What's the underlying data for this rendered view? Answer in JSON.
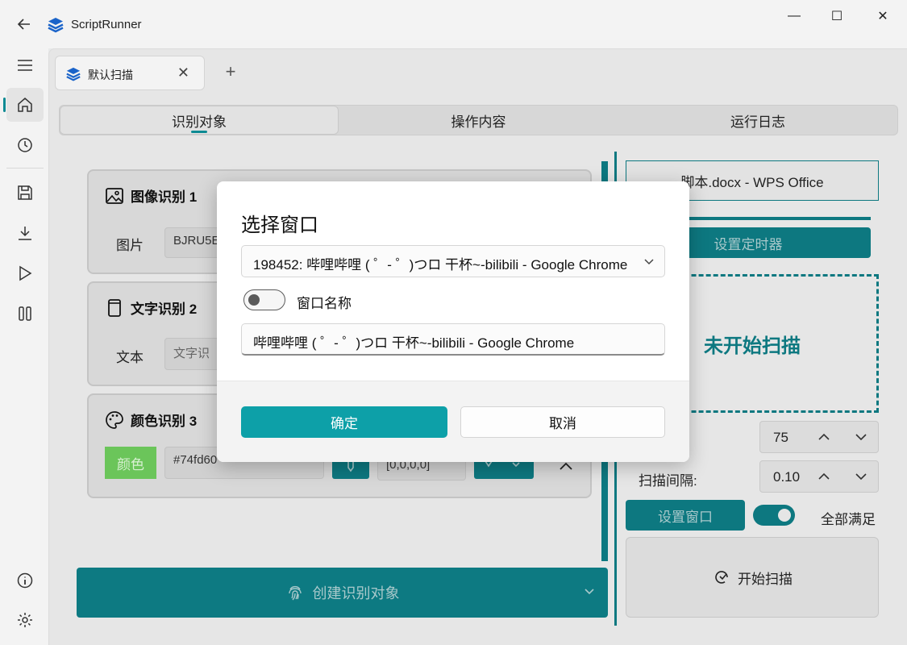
{
  "app": {
    "title": "ScriptRunner"
  },
  "window_controls": {
    "minimize": "—",
    "maximize": "☐",
    "close": "✕"
  },
  "tabs": [
    {
      "label": "默认扫描"
    }
  ],
  "segments": [
    {
      "label": "识别对象",
      "active": true
    },
    {
      "label": "操作内容",
      "active": false
    },
    {
      "label": "运行日志",
      "active": false
    }
  ],
  "cards": {
    "image": {
      "title": "图像识别 1",
      "row_label": "图片",
      "field_value": "BJRU5E"
    },
    "text": {
      "title": "文字识别 2",
      "row_label": "文本",
      "field_placeholder": "文字识"
    },
    "color": {
      "title": "颜色识别 3",
      "swatch_label": "颜色",
      "swatch_color": "#74fd60",
      "hex_value": "#74fd60",
      "rgba_value": "[0,0,0,0]"
    }
  },
  "create_button": {
    "label": "创建识别对象"
  },
  "right_panel": {
    "window_name": "脚本.docx - WPS Office",
    "timer_button": "设置定时器",
    "status": "未开始扫描",
    "threshold_value": "75",
    "interval_label": "扫描间隔:",
    "interval_value": "0.10",
    "set_window_button": "设置窗口",
    "all_satisfy_label": "全部满足",
    "start_button": "开始扫描"
  },
  "dialog": {
    "title": "选择窗口",
    "selected_window": "198452: 哔哩哔哩 ( ゜- ゜)つロ 干杯~-bilibili - Google Chrome",
    "toggle_label": "窗口名称",
    "window_name_value": "哔哩哔哩 ( ゜- ゜)つロ 干杯~-bilibili - Google Chrome",
    "ok_label": "确定",
    "cancel_label": "取消"
  },
  "colors": {
    "accent": "#0d7880",
    "dialog_primary": "#0da0a8"
  }
}
